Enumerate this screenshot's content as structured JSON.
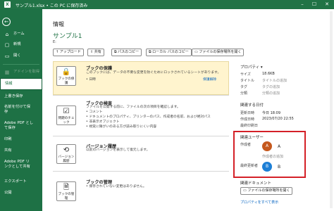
{
  "window": {
    "title": "サンプル1.xlsx • この PC に保存済み",
    "app_icon": "excel-logo",
    "controls": {
      "minimize": "–",
      "maximize": "☐",
      "close": "✕"
    }
  },
  "sidebar": {
    "back": "←",
    "items": [
      {
        "label": "ホーム",
        "icon": "home-icon",
        "glyph": "⌂"
      },
      {
        "label": "新規",
        "icon": "new-file-icon",
        "glyph": "▢"
      },
      {
        "label": "開く",
        "icon": "open-folder-icon",
        "glyph": "▭"
      },
      {
        "label": "アドインを取得",
        "icon": "store-icon",
        "glyph": "▦"
      },
      {
        "label": "情報"
      },
      {
        "label": "上書き保存"
      },
      {
        "label": "名前を付けて保存"
      },
      {
        "label": "Adobe PDF として保存"
      },
      {
        "label": "印刷"
      },
      {
        "label": "共有"
      },
      {
        "label": "Adobe PDF リンクとして共有"
      },
      {
        "label": "エクスポート"
      },
      {
        "label": "公開"
      }
    ]
  },
  "info": {
    "heading": "情報",
    "file_name": "サンプル1",
    "path": "E:",
    "actions": [
      {
        "label": "アップロード",
        "glyph": "↑"
      },
      {
        "label": "共有",
        "glyph": "⇪"
      },
      {
        "label": "パスのコピー",
        "glyph": "⧉"
      },
      {
        "label": "ローカル パスのコピー",
        "glyph": "⧉"
      },
      {
        "label": "ファイルの保存場所を開く",
        "glyph": "▭"
      }
    ],
    "protect": {
      "button": "ブックの保護",
      "title": "ブックの保護",
      "text": "このブックには、データの不要な変更を防ぐためにロックされているシートがあります。",
      "bullet": "日時",
      "link": "保護解除"
    },
    "inspect": {
      "button": "問題のチェック",
      "title": "ブックの検査",
      "text": "ファイルを公開する前に、ファイルの次の項目を確認します。",
      "bullets": [
        "コメント",
        "ドキュメントのプロパティ、プリンターのパス、作成者の名前、および絶対パス",
        "非表示オブジェクト",
        "視覚に障がいのある方が読み取りにくい内容"
      ]
    },
    "version": {
      "button": "バージョン履歴",
      "title": "バージョン履歴",
      "text": "以前のバージョンを表示して復元します。"
    },
    "manage": {
      "button": "ブックの管理",
      "title": "ブックの管理",
      "bullet": "保存されていない変更はありません。"
    }
  },
  "properties": {
    "heading": "プロパティ",
    "rows": [
      {
        "label": "サイズ",
        "value": "18.6KB",
        "gray": false
      },
      {
        "label": "タイトル",
        "value": "タイトルの追加",
        "gray": true
      },
      {
        "label": "タグ",
        "value": "タグの追加",
        "gray": true
      },
      {
        "label": "分類",
        "value": "分類の追加",
        "gray": true
      }
    ],
    "dates_heading": "関連する日付",
    "dates": [
      {
        "label": "更新日時",
        "value": "今日 18:09"
      },
      {
        "label": "作成日時",
        "value": "2023/07/20 22:55"
      },
      {
        "label": "最終印刷日",
        "value": ""
      }
    ],
    "people_heading": "関連ユーザー",
    "author_label": "作成者",
    "author": {
      "initial": "A",
      "name": "A",
      "color": "#c5581d"
    },
    "add_author": "作成者の追加",
    "modifier_label": "最終更新者",
    "modifier": {
      "initial": "B",
      "name": "B",
      "color": "#1d7fd6"
    },
    "docs_heading": "関連ドキュメント",
    "open_location": "ファイルの保存場所を開く",
    "show_all": "プロパティをすべて表示"
  },
  "colors": {
    "brand": "#217346",
    "sidebar": "#1e7145",
    "highlight": "#d42027",
    "protect_bg": "#fff4ce"
  }
}
